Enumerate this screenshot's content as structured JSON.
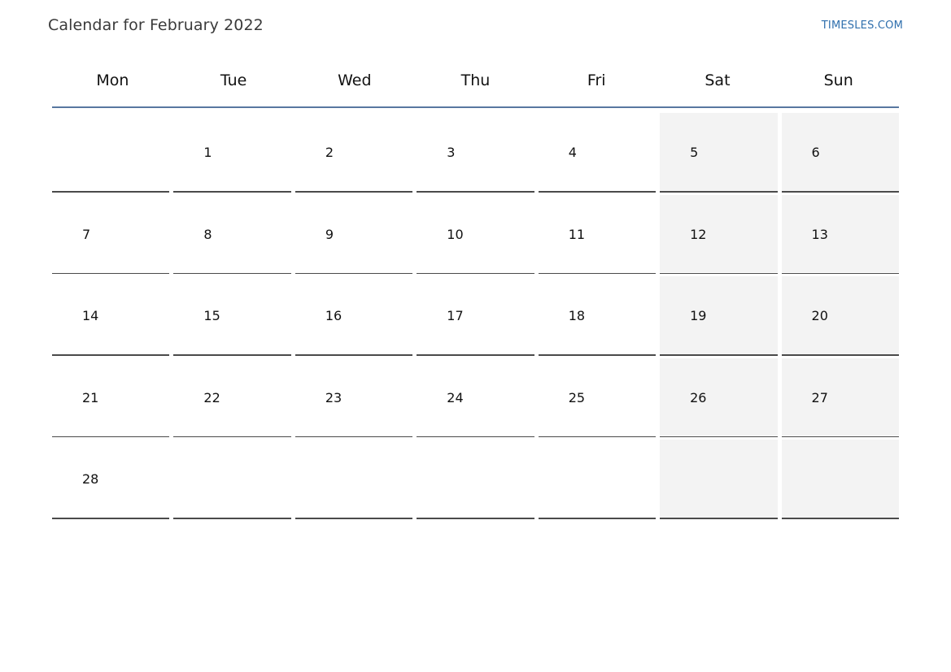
{
  "header": {
    "title": "Calendar for February 2022",
    "brand": "TIMESLES.COM"
  },
  "colors": {
    "brand": "#2f6fad",
    "header_rule": "#5877a0",
    "weekend_bg": "#f3f3f3"
  },
  "weekdays": [
    "Mon",
    "Tue",
    "Wed",
    "Thu",
    "Fri",
    "Sat",
    "Sun"
  ],
  "weeks": [
    [
      "",
      "1",
      "2",
      "3",
      "4",
      "5",
      "6"
    ],
    [
      "7",
      "8",
      "9",
      "10",
      "11",
      "12",
      "13"
    ],
    [
      "14",
      "15",
      "16",
      "17",
      "18",
      "19",
      "20"
    ],
    [
      "21",
      "22",
      "23",
      "24",
      "25",
      "26",
      "27"
    ],
    [
      "28",
      "",
      "",
      "",
      "",
      "",
      ""
    ]
  ]
}
